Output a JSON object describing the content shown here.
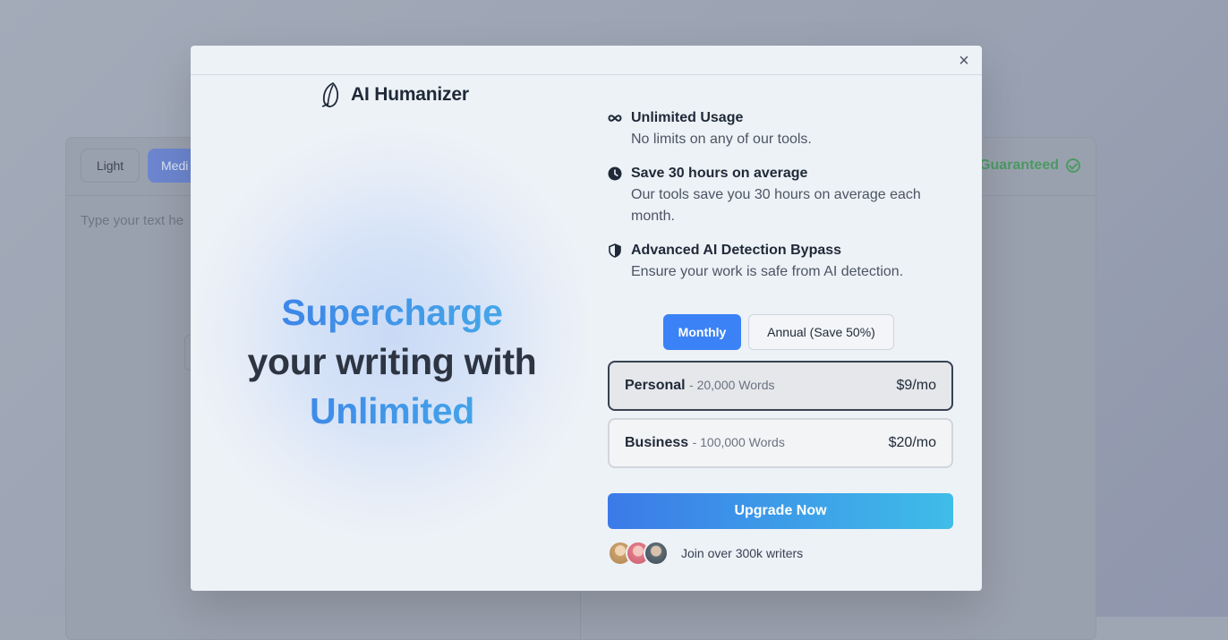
{
  "background": {
    "light_label": "Light",
    "medium_label": "Medi",
    "guaranteed_label": "Guaranteed",
    "placeholder": "Type your text he"
  },
  "modal": {
    "close_label": "×",
    "brand": {
      "name": "AI Humanizer"
    },
    "headline": {
      "part1": "Supercharge",
      "part2": "your writing with",
      "part3": "Unlimited"
    },
    "features": [
      {
        "icon": "infinity-icon",
        "title": "Unlimited Usage",
        "desc": "No limits on any of our tools."
      },
      {
        "icon": "clock-icon",
        "title": "Save 30 hours on average",
        "desc": "Our tools save you 30 hours on average each month."
      },
      {
        "icon": "shield-icon",
        "title": "Advanced AI Detection Bypass",
        "desc": "Ensure your work is safe from AI detection."
      }
    ],
    "billing": {
      "monthly": "Monthly",
      "annual": "Annual (Save 50%)",
      "selected": "Monthly"
    },
    "plans": [
      {
        "name": "Personal",
        "words": "- 20,000 Words",
        "price": "$9/mo",
        "selected": true
      },
      {
        "name": "Business",
        "words": "- 100,000 Words",
        "price": "$20/mo",
        "selected": false
      }
    ],
    "cta": "Upgrade Now",
    "social_proof": "Join over 300k writers"
  },
  "colors": {
    "accent": "#3b82f6",
    "accent_gradient_end": "#3fbde8",
    "success": "#4b9a63"
  }
}
